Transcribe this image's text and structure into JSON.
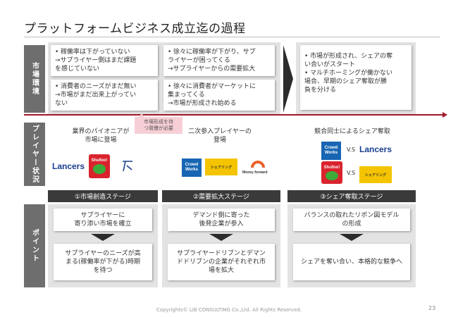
{
  "title": "プラットフォームビジネス成立迄の過程",
  "side_labels": {
    "market": "市場環境",
    "players": "プレイヤー状況",
    "points": "ポイント"
  },
  "market": {
    "card1_lines": [
      "稼働率は下がっていない",
      "→サプライヤー側はまだ課題",
      "を感じていない"
    ],
    "card2_lines": [
      "消費者のニーズがまだ無い",
      "→市場がまだ出来上がってい",
      "ない"
    ],
    "card3_lines": [
      "徐々に稼働率が下がり、サプ",
      "ライヤーが困ってくる",
      "→サプライヤーからの需要拡大"
    ],
    "card4_lines": [
      "徐々に消費者がマーケットに",
      "集まってくる",
      "→市場が形成され始める"
    ],
    "card5_bullet1": [
      "市場が形成され、シェアの奪",
      "い合いがスタート"
    ],
    "card5_bullet2": [
      "マルチホーミングが働かない",
      "場合、早期のシェア奪取が勝",
      "負を分ける"
    ]
  },
  "callout": [
    "市場形成を待",
    "つ我慢が必要"
  ],
  "players": {
    "col1_head": [
      "業界のパイオニアが",
      "市場に登場"
    ],
    "col2_head": [
      "二次参入プレイヤーの",
      "登場"
    ],
    "col3_head": "競合同士によるシェア奪取",
    "vs": "V.S"
  },
  "logos": {
    "lancers": "Lancers",
    "shufoo": "Shufoo!",
    "crowdworks": [
      "Crowd",
      "Works"
    ],
    "moneyforward": "Money forward",
    "small_brand": "シェアリング"
  },
  "stages": [
    "①市場創造ステージ",
    "②需要拡大ステージ",
    "③シェア奪取ステージ"
  ],
  "points": {
    "s1_top": [
      "サプライヤーに",
      "寄り添い市場を確立"
    ],
    "s1_bottom": [
      "サプライヤーのニーズが高",
      "まる(稼働率が下がる)時期",
      "を待つ"
    ],
    "s2_top": [
      "デマンド側に寄った",
      "後発企業が参入"
    ],
    "s2_bottom": [
      "サプライヤードリブンとデマン",
      "ドドリブンの企業がそれぞれ市",
      "場を拡大"
    ],
    "s3_top": [
      "バランスの取れたリボン図モデル",
      "の形成"
    ],
    "s3_bottom": "シェアを奪い合い、本格的な競争へ"
  },
  "footer": "Copyrights© LiB CONSULTING Co.,Ltd. All Rights Reserved.",
  "page_number": "23",
  "colors": {
    "accent_red": "#a0162b",
    "dark_gray": "#3a3a3a",
    "panel_gray": "#e3e3e3",
    "callout_pink": "#f6cfd6"
  }
}
